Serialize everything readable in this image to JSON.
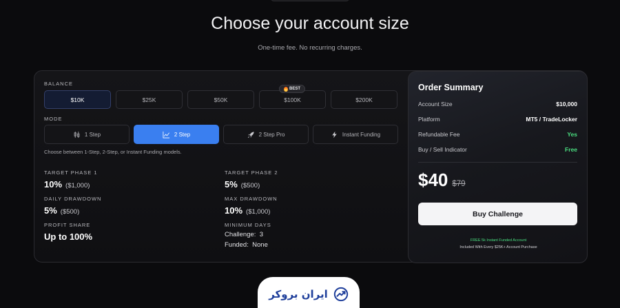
{
  "header": {
    "title": "Choose your account size",
    "subtitle": "One-time fee. No recurring charges."
  },
  "balance": {
    "label": "BALANCE",
    "options": [
      "$10K",
      "$25K",
      "$50K",
      "$100K",
      "$200K"
    ],
    "selected": "$10K",
    "best_badge": "BEST"
  },
  "mode": {
    "label": "MODE",
    "options": [
      "1 Step",
      "2 Step",
      "2 Step Pro",
      "Instant Funding"
    ],
    "selected": "2 Step",
    "help": "Choose between 1-Step, 2-Step, or Instant Funding models."
  },
  "stats": {
    "target_phase_1": {
      "label": "TARGET PHASE 1",
      "value": "10%",
      "sub": "($1,000)"
    },
    "target_phase_2": {
      "label": "TARGET PHASE 2",
      "value": "5%",
      "sub": "($500)"
    },
    "daily_drawdown": {
      "label": "DAILY DRAWDOWN",
      "value": "5%",
      "sub": "($500)"
    },
    "max_drawdown": {
      "label": "MAX DRAWDOWN",
      "value": "10%",
      "sub": "($1,000)"
    },
    "profit_share": {
      "label": "PROFIT SHARE",
      "value": "Up to 100%"
    },
    "minimum_days": {
      "label": "MINIMUM DAYS",
      "challenge": "Challenge:  3",
      "funded": "Funded:  None"
    }
  },
  "summary": {
    "title": "Order Summary",
    "rows": [
      {
        "key": "Account Size",
        "value": "$10,000"
      },
      {
        "key": "Platform",
        "value": "MT5 / TradeLocker"
      },
      {
        "key": "Refundable Fee",
        "value": "Yes"
      },
      {
        "key": "Buy / Sell Indicator",
        "value": "Free"
      }
    ],
    "price": "$40",
    "old_price": "$79",
    "buy_label": "Buy Challenge",
    "promo_line_1": "FREE 5k Instant Funded Account",
    "promo_line_2": "Included With Every $25K+ Account Purchase"
  },
  "brand": {
    "name": "ایران بروکر"
  },
  "colors": {
    "accent": "#3a7ff0",
    "positive": "#4ade80",
    "brand": "#1f3f9b"
  }
}
